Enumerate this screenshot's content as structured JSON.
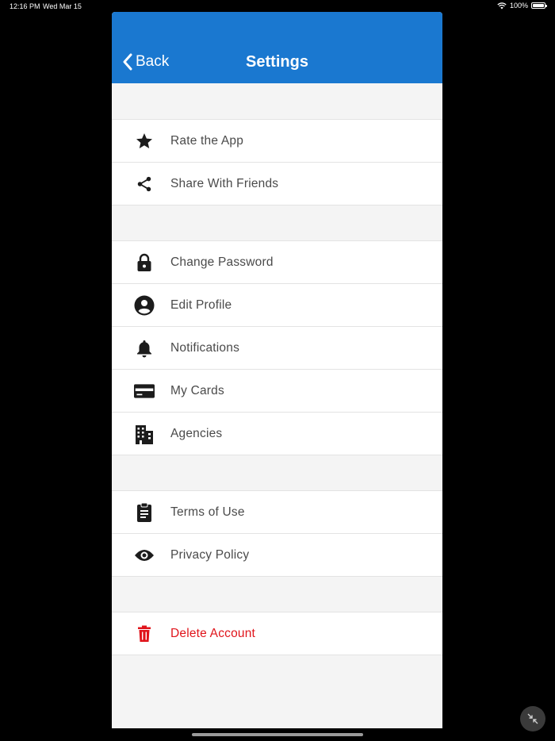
{
  "status_bar": {
    "time": "12:16 PM",
    "date": "Wed Mar 15",
    "battery": "100%"
  },
  "navbar": {
    "back_label": "Back",
    "title": "Settings"
  },
  "groups": [
    {
      "items": [
        {
          "label": "Rate the App",
          "icon": "star-icon"
        },
        {
          "label": "Share With Friends",
          "icon": "share-icon"
        }
      ]
    },
    {
      "items": [
        {
          "label": "Change Password",
          "icon": "lock-icon"
        },
        {
          "label": "Edit Profile",
          "icon": "account-circle-icon"
        },
        {
          "label": "Notifications",
          "icon": "bell-icon"
        },
        {
          "label": "My Cards",
          "icon": "credit-card-icon"
        },
        {
          "label": "Agencies",
          "icon": "building-icon"
        }
      ]
    },
    {
      "items": [
        {
          "label": "Terms of Use",
          "icon": "clipboard-icon"
        },
        {
          "label": "Privacy Policy",
          "icon": "eye-icon"
        }
      ]
    },
    {
      "items": [
        {
          "label": "Delete Account",
          "icon": "trash-icon"
        }
      ]
    }
  ],
  "colors": {
    "navbar": "#1a78d0",
    "danger": "#e0141b",
    "text": "#4a4a4a",
    "background": "#f4f4f4"
  }
}
